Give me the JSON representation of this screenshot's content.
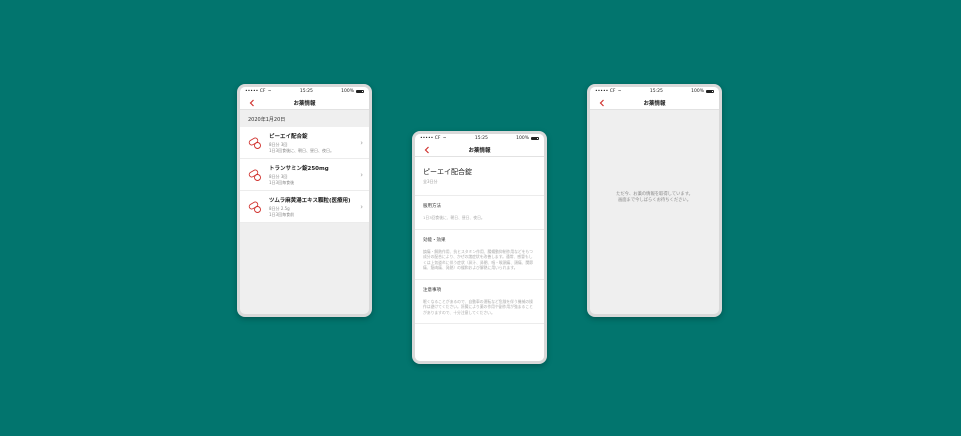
{
  "status": {
    "carrier": "••••• CF",
    "time": "15:25",
    "battery": "100%"
  },
  "colors": {
    "background": "#02756e",
    "accent": "#d0312d"
  },
  "phone1": {
    "title": "お薬情報",
    "date": "2020年1月20日",
    "items": [
      {
        "name": "ピーエイ配合錠",
        "sub1": "8日分 3回",
        "sub2": "1日3回食後に、朝日、昼日、夜日。"
      },
      {
        "name": "トランサミン錠250mg",
        "sub1": "8日分 3回",
        "sub2": "1日3回毎食後"
      },
      {
        "name": "ツムラ麻黄湯エキス顆粒(医療用)",
        "sub1": "8日分 2.5g",
        "sub2": "1日3回毎食前"
      }
    ]
  },
  "phone2": {
    "title": "お薬情報",
    "drug_name": "ピーエイ配合錠",
    "drug_sub": "全3日分",
    "sections": [
      {
        "label": "服用方法",
        "body": "1日3回食後に、朝日、昼日、夜日。"
      },
      {
        "label": "効能・効果",
        "body": "鎮痛・解熱作用、抗ヒスタミン作用、腸蠕動抑制作用などをもつ成分の配合により、かぜの諸症状を改善します。通常、感冒もしくは上気道炎に伴う症状（鼻汁、鼻閉、咽・喉頭痛、頭痛、関節痛、筋肉痛、発熱）の緩和および解熱に用いられます。"
      },
      {
        "label": "注意事項",
        "body": "眠くなることがあるので、自動車の運転など危険を伴う機械の操作は避けてください。肝臓により薬の作用や副作用が強まることがありますので、十分注意してください。"
      }
    ]
  },
  "phone3": {
    "title": "お薬情報",
    "loading_line1": "ただ今、お薬の情報を取得しています。",
    "loading_line2": "画面まで今しばらくお待ちください。"
  }
}
